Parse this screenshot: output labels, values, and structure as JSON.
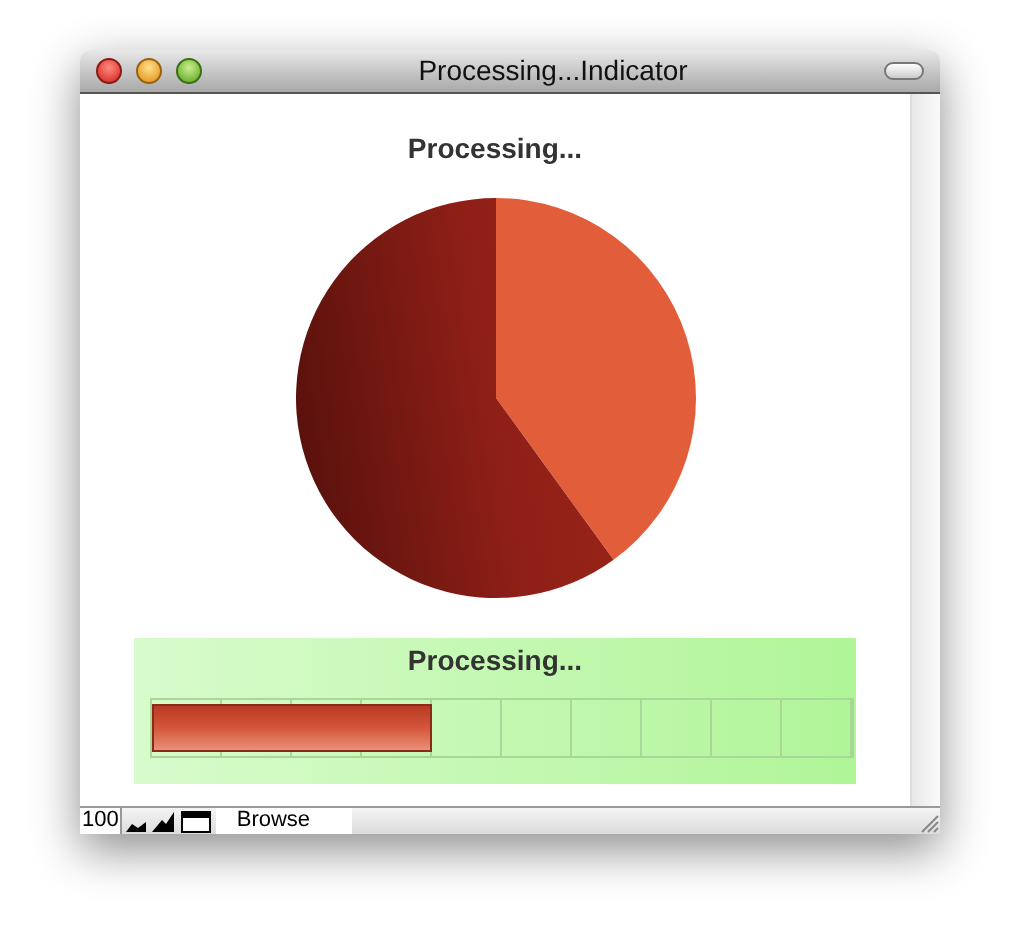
{
  "window": {
    "title": "Processing...Indicator"
  },
  "pie_chart": {
    "title": "Processing..."
  },
  "progress": {
    "title": "Processing...",
    "level": 0.4
  },
  "status_bar": {
    "zoom": "100",
    "mode": "Browse"
  }
}
